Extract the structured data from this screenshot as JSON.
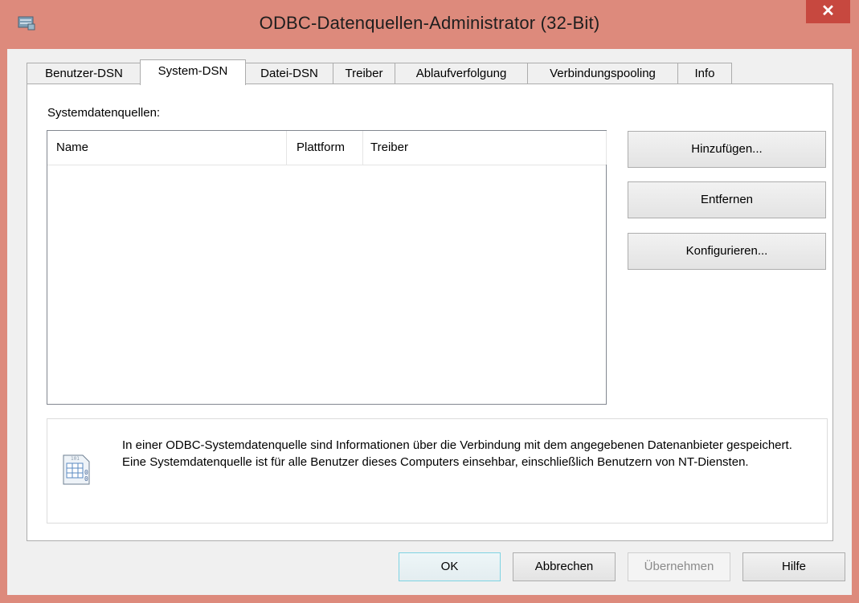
{
  "window": {
    "title": "ODBC-Datenquellen-Administrator (32-Bit)",
    "close_glyph": "✕"
  },
  "tabs": [
    {
      "label": "Benutzer-DSN"
    },
    {
      "label": "System-DSN"
    },
    {
      "label": "Datei-DSN"
    },
    {
      "label": "Treiber"
    },
    {
      "label": "Ablaufverfolgung"
    },
    {
      "label": "Verbindungspooling"
    },
    {
      "label": "Info"
    }
  ],
  "active_tab": "System-DSN",
  "panel": {
    "label": "Systemdatenquellen:",
    "columns": [
      "Name",
      "Plattform",
      "Treiber"
    ],
    "rows": []
  },
  "side_buttons": {
    "add": "Hinzufügen...",
    "remove": "Entfernen",
    "configure": "Konfigurieren..."
  },
  "info_text": "In einer ODBC-Systemdatenquelle sind Informationen über die Verbindung mit dem angegebenen Datenanbieter gespeichert. Eine Systemdatenquelle ist für alle Benutzer dieses Computers einsehbar, einschließlich Benutzern von NT-Diensten.",
  "bottom_buttons": {
    "ok": "OK",
    "cancel": "Abbrechen",
    "apply": "Übernehmen",
    "help": "Hilfe"
  },
  "colors": {
    "titlebar": "#dd8a7c",
    "close": "#c7483f",
    "client": "#f0f0f0"
  }
}
